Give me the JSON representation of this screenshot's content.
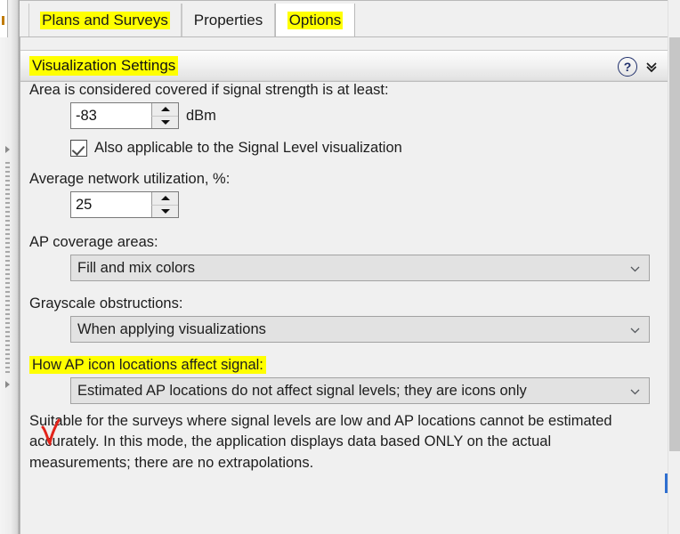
{
  "tabs": [
    {
      "id": "plans",
      "label": "Plans and Surveys",
      "active": false,
      "highlighted": false
    },
    {
      "id": "properties",
      "label": "Properties",
      "active": false,
      "highlighted": false
    },
    {
      "id": "options",
      "label": "Options",
      "active": true,
      "highlighted": true
    }
  ],
  "group": {
    "title": "Visualization Settings",
    "title_highlighted": true,
    "help_icon": "question-mark-icon",
    "help_glyph": "?",
    "collapse_icon": "chevron-double-down-icon"
  },
  "settings": {
    "coverage_label": "Area is considered covered if signal strength is at least:",
    "coverage_value": "-83",
    "coverage_unit": "dBm",
    "also_applicable_label": "Also applicable to the Signal Level visualization",
    "also_applicable_checked": true,
    "utilization_label": "Average network utilization, %:",
    "utilization_value": "25",
    "ap_coverage_label": "AP coverage areas:",
    "ap_coverage_value": "Fill and mix colors",
    "grayscale_label": "Grayscale obstructions:",
    "grayscale_value": "When applying visualizations",
    "ap_icon_label": "How AP icon locations affect signal:",
    "ap_icon_label_highlighted": true,
    "ap_icon_value": "Estimated AP locations do not affect signal levels; they are icons only",
    "description": "Suitable for the surveys where signal levels are low and AP locations cannot be estimated accurately. In this mode, the application displays data based ONLY on the actual measurements; there are no extrapolations."
  },
  "annotations": {
    "highlight_color": "#ffff00",
    "red_check_color": "#e2231a",
    "accent_color": "#1f2f6b"
  },
  "scrollbar": {
    "orientation": "vertical"
  },
  "splitter": {
    "up_icon": "triangle-up-icon",
    "down_icon": "triangle-down-icon"
  }
}
